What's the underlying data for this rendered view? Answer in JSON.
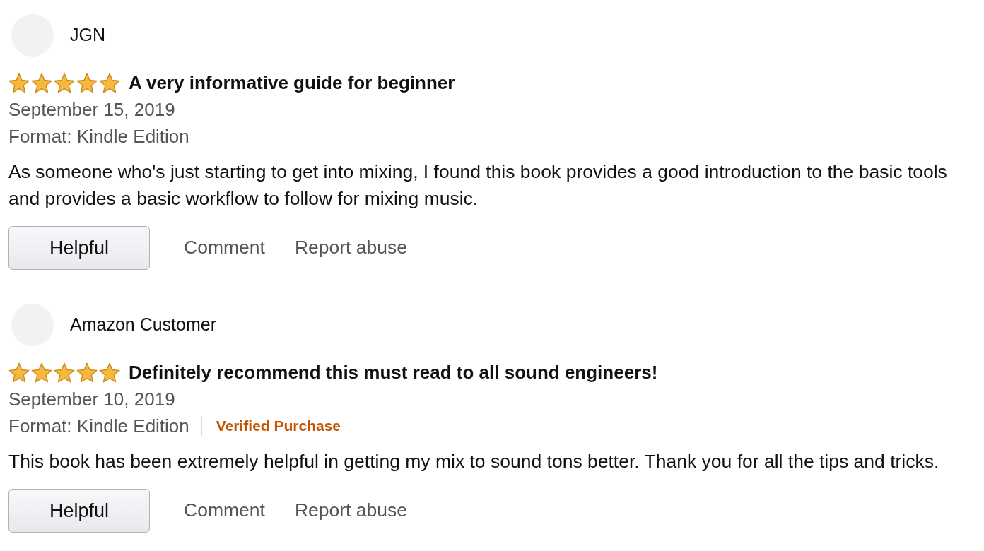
{
  "reviews": [
    {
      "author": "JGN",
      "stars": 5,
      "title": "A very informative guide for beginner",
      "date": "September 15, 2019",
      "format": "Format: Kindle Edition",
      "body": "As someone who's just starting to get into mixing, I found this book provides a good introduction to the basic tools and provides a basic workflow to follow for mixing music.",
      "actions": [
        {
          "kind": "button",
          "label": "Helpful"
        },
        {
          "kind": "link",
          "label": "Comment"
        },
        {
          "kind": "link",
          "label": "Report abuse"
        }
      ]
    },
    {
      "author": "Amazon Customer",
      "stars": 5,
      "title": "Definitely recommend this must read to all sound engineers!",
      "date": "September 10, 2019",
      "format": "Format: Kindle Edition",
      "badge": "Verified Purchase",
      "body": "This book has been extremely helpful in getting my mix to sound tons better. Thank you for all the tips and tricks.",
      "actions": [
        {
          "kind": "button",
          "label": "Helpful"
        },
        {
          "kind": "link",
          "label": "Comment"
        },
        {
          "kind": "link",
          "label": "Report abuse"
        }
      ]
    }
  ]
}
